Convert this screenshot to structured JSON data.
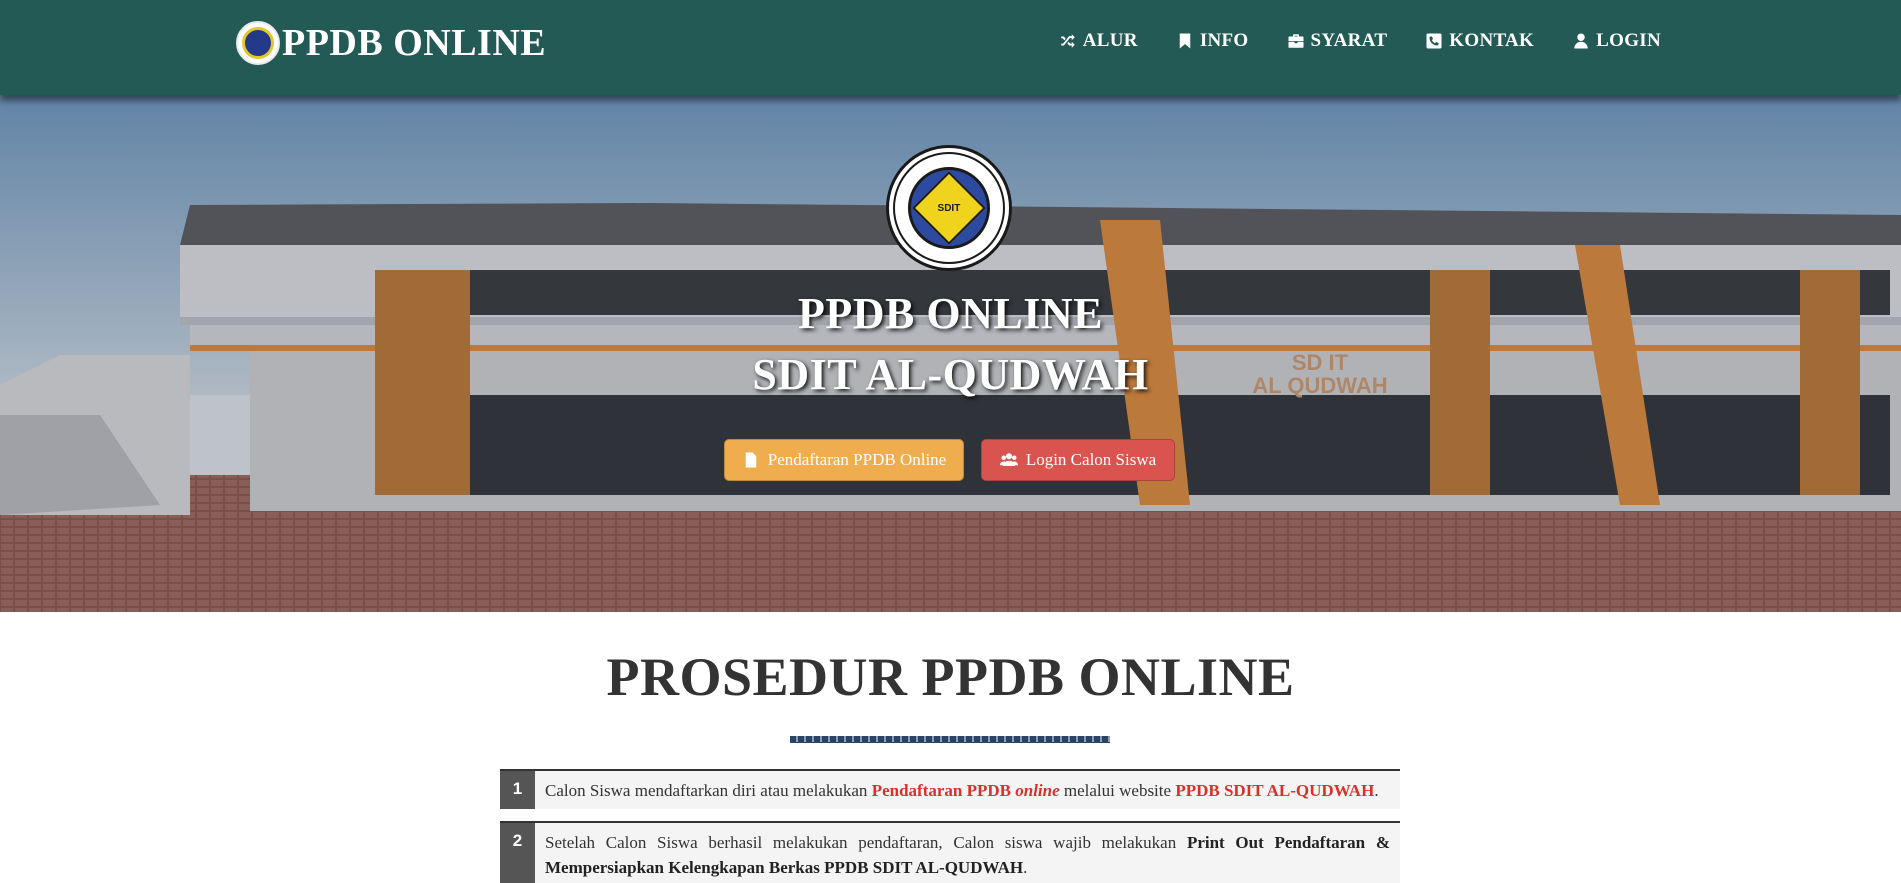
{
  "navbar": {
    "brand": "PPDB ONLINE",
    "items": [
      {
        "label": "ALUR",
        "icon": "random-icon"
      },
      {
        "label": "INFO",
        "icon": "bookmark-icon"
      },
      {
        "label": "SYARAT",
        "icon": "briefcase-icon"
      },
      {
        "label": "KONTAK",
        "icon": "phone-icon"
      },
      {
        "label": "LOGIN",
        "icon": "user-icon"
      }
    ]
  },
  "hero": {
    "title_line1": "PPDB ONLINE",
    "title_line2": "SDIT AL-QUDWAH",
    "building_sign_line1": "SD IT",
    "building_sign_line2": "AL QUDWAH",
    "emblem_text": "SDIT",
    "emblem_ring_top": "SEKOLAH DASAR ISLAM TERPADU AL-QUDWAH",
    "emblem_ring_bottom": "PEKANBARU",
    "btn_register": "Pendaftaran PPDB Online",
    "btn_login": "Login Calon Siswa"
  },
  "section": {
    "title": "PROSEDUR PPDB ONLINE"
  },
  "steps": [
    {
      "num": "1",
      "t1": "Calon Siswa mendaftarkan diri atau melakukan ",
      "h1": "Pendaftaran PPDB ",
      "h1i": "online",
      "t2": " melalui website ",
      "h2": "PPDB SDIT AL-QUDWAH",
      "t3": "."
    },
    {
      "num": "2",
      "t1": "Setelah Calon Siswa berhasil melakukan pendaftaran, Calon siswa wajib melakukan ",
      "b1": "Print Out Pendaftaran & Mempersiapkan Kelengkapan Berkas PPDB SDIT AL-QUDWAH",
      "t2": "."
    }
  ],
  "colors": {
    "navbar": "#245a56",
    "warning": "#f0ad4e",
    "danger": "#d9534f",
    "highlight": "#d9302c"
  }
}
